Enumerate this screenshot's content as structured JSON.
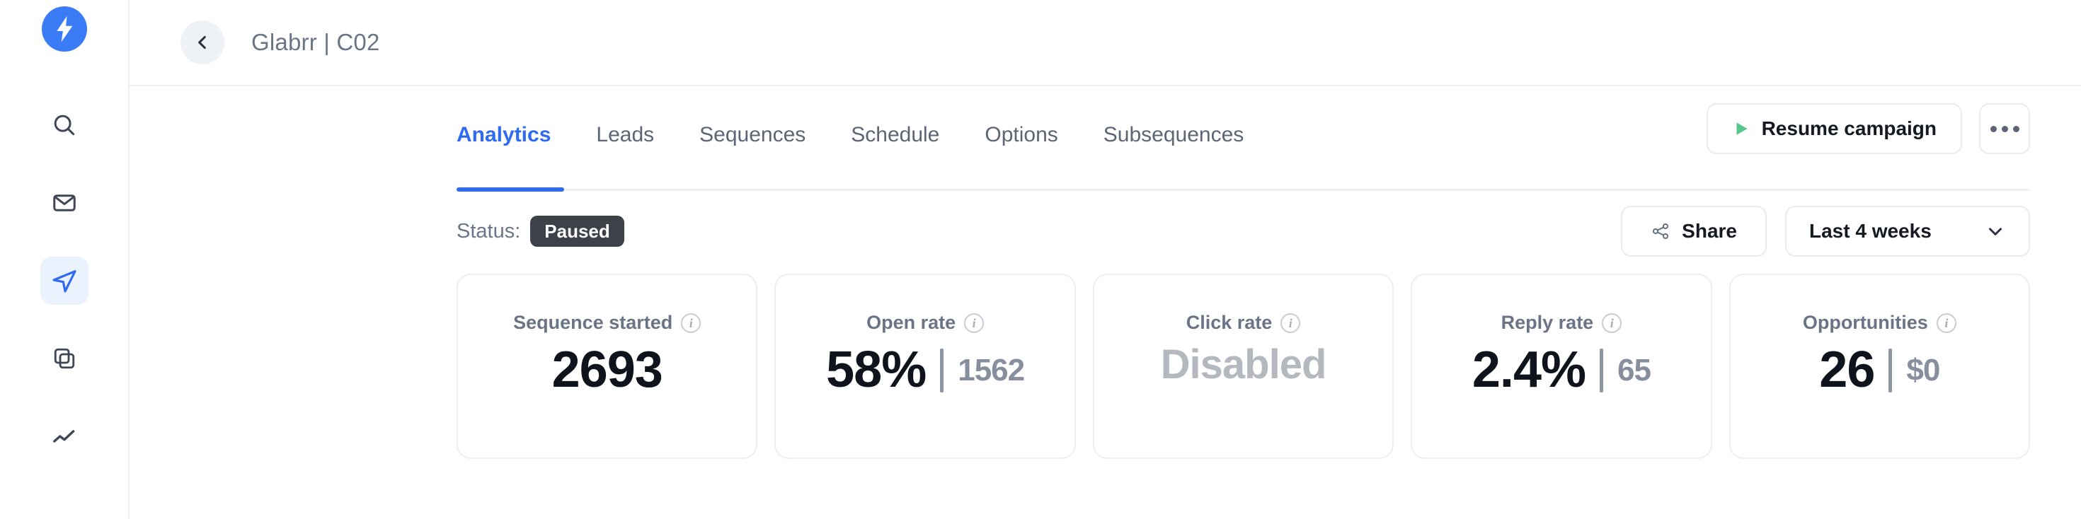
{
  "brand": {
    "logo_icon": "lightning-bolt-icon",
    "accent_color": "#3b7cf6"
  },
  "sidebar": {
    "items": [
      {
        "icon": "search-icon",
        "name": "search",
        "active": false
      },
      {
        "icon": "envelope-icon",
        "name": "inbox",
        "active": false
      },
      {
        "icon": "paper-plane-icon",
        "name": "campaigns",
        "active": true
      },
      {
        "icon": "copy-layers-icon",
        "name": "templates",
        "active": false
      },
      {
        "icon": "line-chart-icon",
        "name": "analytics",
        "active": false
      }
    ]
  },
  "header": {
    "back_icon": "chevron-left-icon",
    "title": "Glabrr | C02"
  },
  "tabs": [
    {
      "label": "Analytics",
      "active": true
    },
    {
      "label": "Leads",
      "active": false
    },
    {
      "label": "Sequences",
      "active": false
    },
    {
      "label": "Schedule",
      "active": false
    },
    {
      "label": "Options",
      "active": false
    },
    {
      "label": "Subsequences",
      "active": false
    }
  ],
  "top_actions": {
    "resume_label": "Resume campaign",
    "resume_icon": "play-triangle-icon",
    "resume_icon_color": "#57c88b",
    "more_icon": "ellipsis-icon"
  },
  "status": {
    "label": "Status:",
    "value": "Paused",
    "badge_color": "#3d4148"
  },
  "filters": {
    "share_label": "Share",
    "share_icon": "share-nodes-icon",
    "range_value": "Last 4 weeks",
    "range_icon": "chevron-down-icon"
  },
  "metrics": [
    {
      "label": "Sequence started",
      "info_icon": "info-circle-icon",
      "value": "2693",
      "separator": false,
      "sub_value": "",
      "disabled": false
    },
    {
      "label": "Open rate",
      "info_icon": "info-circle-icon",
      "value": "58%",
      "separator": true,
      "sub_value": "1562",
      "disabled": false
    },
    {
      "label": "Click rate",
      "info_icon": "info-circle-icon",
      "value": "Disabled",
      "separator": false,
      "sub_value": "",
      "disabled": true
    },
    {
      "label": "Reply rate",
      "info_icon": "info-circle-icon",
      "value": "2.4%",
      "separator": true,
      "sub_value": "65",
      "disabled": false
    },
    {
      "label": "Opportunities",
      "info_icon": "info-circle-icon",
      "value": "26",
      "separator": true,
      "sub_value": "$0",
      "disabled": false
    }
  ]
}
